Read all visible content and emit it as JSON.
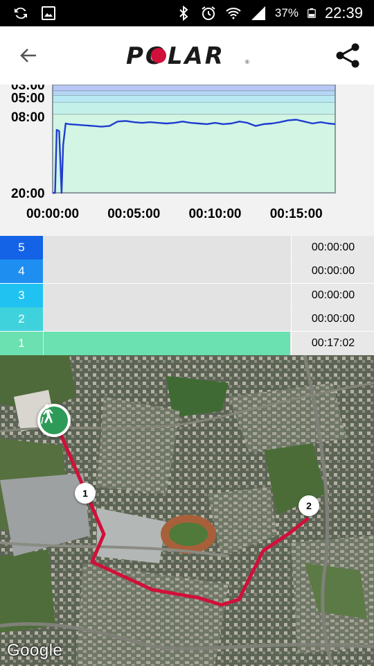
{
  "status_bar": {
    "battery_percent": "37%",
    "time": "22:39",
    "icons": [
      "sync-icon",
      "image-icon",
      "bluetooth-icon",
      "alarm-icon",
      "wifi-icon",
      "signal-icon",
      "battery-icon"
    ]
  },
  "app_bar": {
    "logo_text": "POLAR",
    "back_icon": "arrow-back-icon",
    "share_icon": "share-icon"
  },
  "chart_data": {
    "type": "line",
    "y_tick_labels": [
      "03:00",
      "05:00",
      "08:00",
      "20:00"
    ],
    "x_tick_labels": [
      "00:00:00",
      "00:05:00",
      "00:10:00",
      "00:15:00"
    ],
    "x_unit": "minutes",
    "xlim": [
      0,
      17.4
    ],
    "ylim": [
      20,
      3
    ],
    "y_reversed": true,
    "zone_band_colors": [
      "#b7c8f5",
      "#b5d7f5",
      "#b8e9f2",
      "#c4f0ea",
      "#d2f5e4"
    ],
    "line_color": "#1f3ccf",
    "series": [
      {
        "x": [
          0,
          0.15,
          0.25,
          0.4,
          0.55,
          0.65,
          0.8,
          1.0,
          1.5,
          2.0,
          2.5,
          3.0,
          3.5,
          4.0,
          4.5,
          5.0,
          5.5,
          6.0,
          6.5,
          7.0,
          7.5,
          8.0,
          8.5,
          9.0,
          9.5,
          10.0,
          10.5,
          11.0,
          11.5,
          12.0,
          12.5,
          13.0,
          13.5,
          14.0,
          14.5,
          15.0,
          15.5,
          16.0,
          16.5,
          17.0,
          17.4
        ],
        "y": [
          20,
          20,
          10.1,
          10.3,
          20,
          12.5,
          9.1,
          9.2,
          9.3,
          9.4,
          9.5,
          9.6,
          9.5,
          8.8,
          8.7,
          8.9,
          9.0,
          8.9,
          9.0,
          9.1,
          9.0,
          8.8,
          9.0,
          9.1,
          9.2,
          9.0,
          9.2,
          9.1,
          8.8,
          9.0,
          9.5,
          9.2,
          9.1,
          8.9,
          8.6,
          8.5,
          8.8,
          9.1,
          8.9,
          9.1,
          9.2
        ]
      }
    ]
  },
  "zones": [
    {
      "label": "5",
      "time": "00:00:00",
      "fraction": 0,
      "color": "#1462e6"
    },
    {
      "label": "4",
      "time": "00:00:00",
      "fraction": 0,
      "color": "#1e8ff0"
    },
    {
      "label": "3",
      "time": "00:00:00",
      "fraction": 0,
      "color": "#1fc2f0"
    },
    {
      "label": "2",
      "time": "00:00:00",
      "fraction": 0,
      "color": "#3fd2dc"
    },
    {
      "label": "1",
      "time": "00:17:02",
      "fraction": 1,
      "color": "#6be0b0"
    }
  ],
  "map": {
    "markers": [
      "1",
      "2"
    ],
    "start_icon": "walking-person-icon",
    "route_color": "#d0103a",
    "attribution": "Google"
  }
}
